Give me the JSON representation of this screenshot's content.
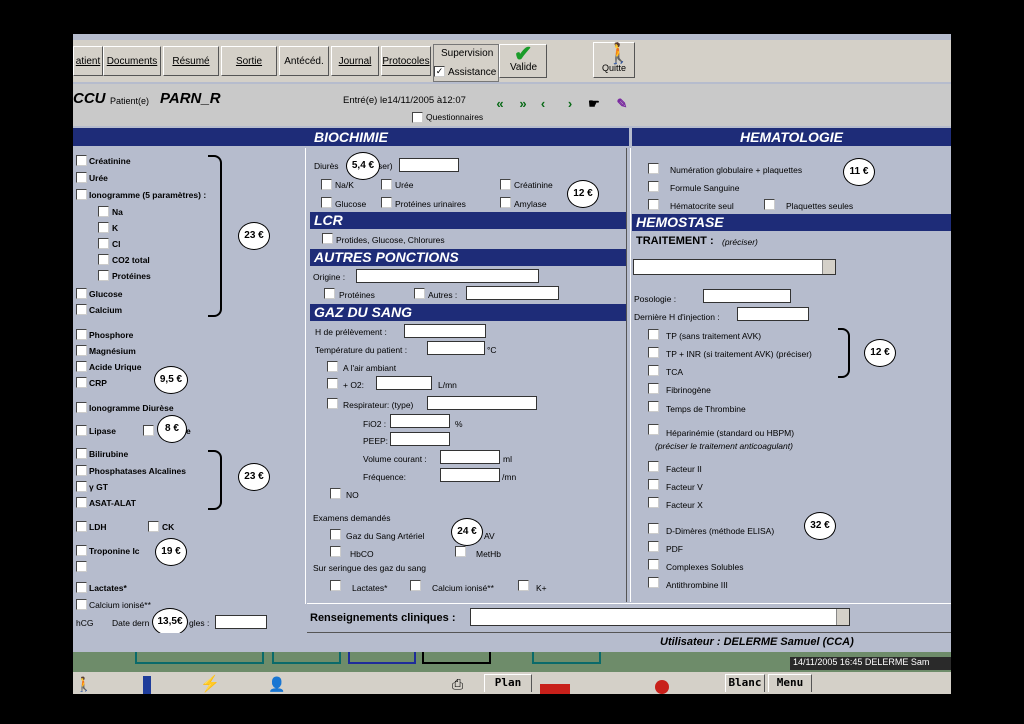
{
  "toolbar": {
    "patient": "atient",
    "documents": "Documents",
    "resume": "Résumé",
    "sortie": "Sortie",
    "antecedents": "Antécéd.",
    "journal": "Journal",
    "protocoles": "Protocoles",
    "supervision": "Supervision",
    "assistance": "Assistance",
    "valide": "Valide",
    "quitter": "Quitte"
  },
  "header": {
    "service": "CCU",
    "patient_label": "Patient(e)",
    "patient_name": "PARN_R",
    "entry": "Entré(e) le14/11/2005  à12:07",
    "questionnaires": "Questionnaires"
  },
  "biochimie": {
    "title": "BIOCHIMIE",
    "left": {
      "creatinine": "Créatinine",
      "uree": "Urée",
      "ionogramme": "Ionogramme (5 paramètres) :",
      "na": "Na",
      "k": "K",
      "cl": "Cl",
      "co2": "CO2 total",
      "proteines": "Protéines",
      "glucose": "Glucose",
      "calcium": "Calcium",
      "phosphore": "Phosphore",
      "magnesium": "Magnésium",
      "acide_urique": "Acide Urique",
      "crp": "CRP",
      "ionogramme_diurese": "Ionogramme Diurèse",
      "lipase": "Lipase",
      "lipase_suffix": "e",
      "bilirubine": "Bilirubine",
      "phosphatases": "Phosphatases Alcalines",
      "ggt": "γ GT",
      "asat": "ASAT-ALAT",
      "ldh": "LDH",
      "ck": "CK",
      "troponine": "Troponine Ic",
      "lactates": "Lactates*",
      "calcium_ionise": "Calcium ionisé**",
      "hcg": "hCG",
      "date_regles": "Date dern",
      "date_regles_suffix": "gles :"
    },
    "mid": {
      "diurese": "Diurès",
      "diurese_suffix": "ser)",
      "nak": "Na/K",
      "uree": "Urée",
      "creatinine": "Créatinine",
      "glucose": "Glucose",
      "proteines_urinaires": "Protéines urinaires",
      "amylase": "Amylase"
    }
  },
  "lcr": {
    "title": "LCR",
    "item": "Protides, Glucose, Chlorures"
  },
  "autres": {
    "title": "AUTRES PONCTIONS",
    "origine": "Origine :",
    "proteines": "Protéines",
    "autres": "Autres :"
  },
  "gaz": {
    "title": "GAZ DU SANG",
    "h_prelevement": "H de prélèvement :",
    "temperature": "Température du patient :",
    "temp_unit": "°C",
    "air_ambiant": "A l'air ambiant",
    "o2": "+ O2:",
    "o2_unit": "L/mn",
    "respirateur": "Respirateur: (type)",
    "fio2": "FiO2 :",
    "fio2_unit": "%",
    "peep": "PEEP:",
    "volume": "Volume courant :",
    "volume_unit": "ml",
    "frequence": "Fréquence:",
    "freq_unit": "/mn",
    "no": "NO",
    "examens": "Examens demandés",
    "gaz_arteriel": "Gaz du Sang Artériel",
    "av": "AV",
    "hbco": "HbCO",
    "methb": "MetHb",
    "seringue": "Sur seringue des gaz du sang",
    "lactates": "Lactates*",
    "calcium_ionise": "Calcium ionisé**",
    "kplus": "K+"
  },
  "hematologie": {
    "title": "HEMATOLOGIE",
    "numeration": "Numération globulaire + plaquettes",
    "formule": "Formule Sanguine",
    "hematocrite": "Hématocrite seul",
    "plaquettes": "Plaquettes seules"
  },
  "hemostase": {
    "title": "HEMOSTASE",
    "traitement": "TRAITEMENT :",
    "preciser": "(préciser)",
    "posologie": "Posologie :",
    "derniere": "Dernière H d'injection :",
    "tp_sans": "TP (sans traitement AVK)",
    "tp_inr": "TP + INR (si traitement AVK) (préciser)",
    "tca": "TCA",
    "fibrinogene": "Fibrinogène",
    "thrombine": "Temps de Thrombine",
    "heparinemie": "Héparinémie (standard ou HBPM)",
    "heparinemie_note": "(préciser le traitement anticoagulant)",
    "facteur2": "Facteur II",
    "facteur5": "Facteur V",
    "facteur10": "Facteur X",
    "ddimeres": "D-Dimères (méthode ELISA)",
    "pdf": "PDF",
    "complexes": "Complexes Solubles",
    "antithrombine": "Antithrombine III"
  },
  "footer": {
    "renseignements": "Renseignements cliniques :",
    "utilisateur": "Utilisateur : DELERME Samuel (CCA)",
    "status": "14/11/2005 16:45  DELERME Sam",
    "plan": "Plan",
    "blanc": "Blanc",
    "menu": "Menu"
  },
  "prices": {
    "diurese": "5,4 €",
    "urinaires": "12 €",
    "ionogramme": "23 €",
    "crp": "9,5 €",
    "lipase": "8 €",
    "hepatic": "23 €",
    "troponine": "19 €",
    "hcg": "13,5€",
    "numeration": "11 €",
    "tp": "12 €",
    "gaz": "24 €",
    "ddimeres": "32 €"
  },
  "colors": {
    "header_blue": "#1e2c78",
    "panel_bg": "#b6bccd"
  }
}
